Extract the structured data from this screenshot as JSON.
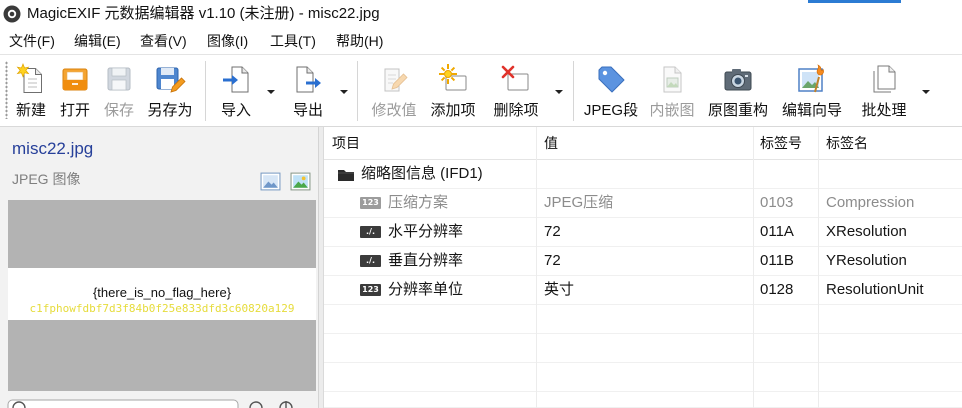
{
  "window": {
    "title": "MagicEXIF 元数据编辑器 v1.10 (未注册) - misc22.jpg",
    "app_icon": "app-logo-icon"
  },
  "menu": {
    "items": [
      "文件(F)",
      "编辑(E)",
      "查看(V)",
      "图像(I)",
      "工具(T)",
      "帮助(H)"
    ]
  },
  "toolbar": {
    "items": [
      {
        "label": "新建",
        "icon": "new-document-icon",
        "enabled": true
      },
      {
        "label": "打开",
        "icon": "open-folder-icon",
        "enabled": true
      },
      {
        "label": "保存",
        "icon": "save-icon",
        "enabled": false
      },
      {
        "label": "另存为",
        "icon": "save-as-icon",
        "enabled": true
      },
      {
        "label": "导入",
        "icon": "import-icon",
        "enabled": true,
        "dropdown": true
      },
      {
        "label": "导出",
        "icon": "export-icon",
        "enabled": true,
        "dropdown": true
      },
      {
        "label": "修改值",
        "icon": "modify-value-icon",
        "enabled": false
      },
      {
        "label": "添加项",
        "icon": "add-item-icon",
        "enabled": true
      },
      {
        "label": "删除项",
        "icon": "delete-item-icon",
        "enabled": true,
        "dropdown": true
      },
      {
        "label": "JPEG段",
        "icon": "jpeg-segment-tag-icon",
        "enabled": true
      },
      {
        "label": "内嵌图",
        "icon": "embedded-image-icon",
        "enabled": false
      },
      {
        "label": "原图重构",
        "icon": "camera-icon",
        "enabled": true
      },
      {
        "label": "编辑向导",
        "icon": "edit-wizard-icon",
        "enabled": true
      },
      {
        "label": "批处理",
        "icon": "batch-documents-icon",
        "enabled": true,
        "dropdown": true
      }
    ]
  },
  "file_panel": {
    "file_name": "misc22.jpg",
    "file_type": "JPEG 图像",
    "view_icons": [
      "image-thumbnail-icon",
      "image-color-icon"
    ],
    "preview": {
      "text": "{there_is_no_flag_here}",
      "hidden_text": "c1fphowfdbf7d3f84b0f25e833dfd3c60820a129"
    },
    "zoom_icons": [
      "search-icon",
      "zoom-out-icon",
      "zoom-in-icon"
    ]
  },
  "table": {
    "columns": [
      "项目",
      "值",
      "标签号",
      "标签名"
    ],
    "group": {
      "icon": "folder-icon",
      "label": "缩略图信息 (IFD1)"
    },
    "rows": [
      {
        "badge": "123",
        "icon": "integer-type-icon",
        "item": "压缩方案",
        "value": "JPEG压缩",
        "tag": "0103",
        "name": "Compression",
        "dimmed": true
      },
      {
        "badge": "./.",
        "icon": "rational-type-icon",
        "item": "水平分辨率",
        "value": "72",
        "tag": "011A",
        "name": "XResolution",
        "dimmed": false
      },
      {
        "badge": "./.",
        "icon": "rational-type-icon",
        "item": "垂直分辨率",
        "value": "72",
        "tag": "011B",
        "name": "YResolution",
        "dimmed": false
      },
      {
        "badge": "123",
        "icon": "integer-type-icon",
        "item": "分辨率单位",
        "value": "英寸",
        "tag": "0128",
        "name": "ResolutionUnit",
        "dimmed": false
      }
    ]
  },
  "colors": {
    "file-name": "#27409a",
    "dimmed-text": "#8c8c8c",
    "preview-background": "#b3b3b3",
    "preview-band": "#ffffff",
    "hidden-text": "#e6dc3c",
    "title-highlight": "#2b7bd3"
  }
}
